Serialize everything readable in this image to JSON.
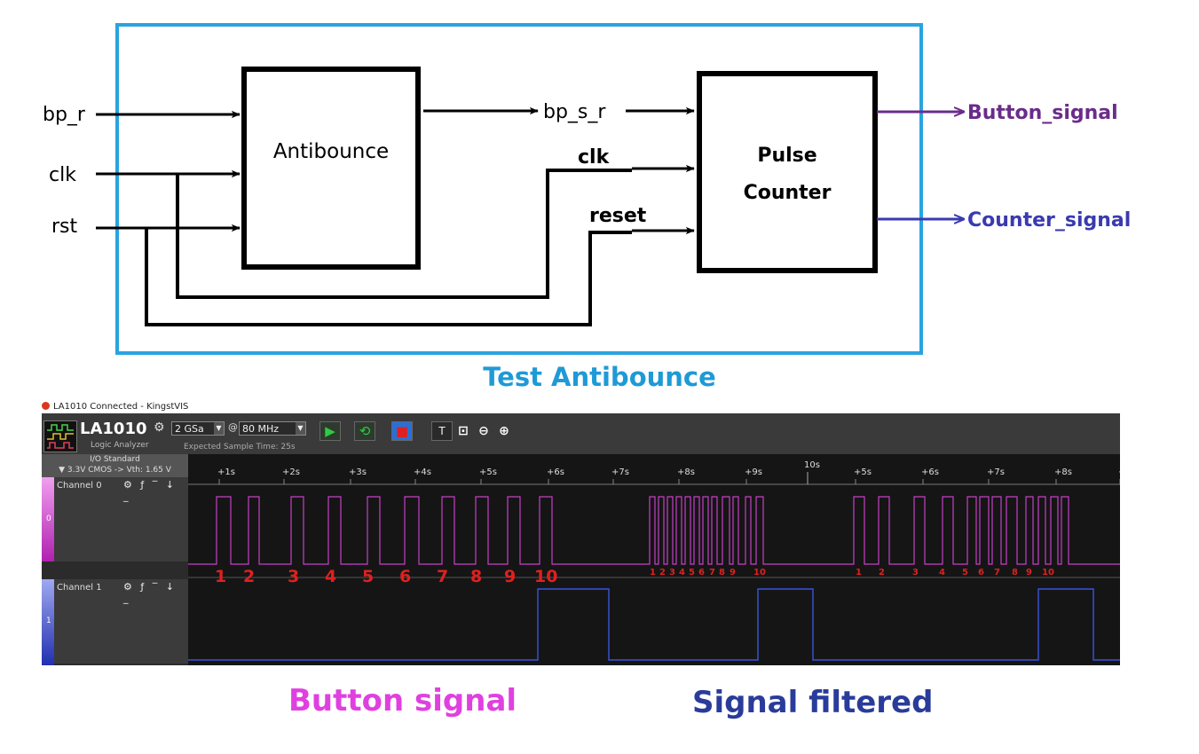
{
  "diagram": {
    "antibounce": {
      "label": "Antibounce"
    },
    "pulse_counter": {
      "line1": "Pulse",
      "line2": "Counter"
    },
    "inputs": [
      "bp_r",
      "clk",
      "rst"
    ],
    "middle_labels": {
      "bp_s_r": "bp_s_r",
      "clk": "clk",
      "reset": "reset"
    },
    "outputs": [
      {
        "label": "Button_signal",
        "color": "#6a2c8a"
      },
      {
        "label": "Counter_signal",
        "color": "#3a3ab0"
      }
    ],
    "frame_color": "#2aa3e0",
    "caption": "Test Antibounce"
  },
  "app": {
    "window_title": "LA1010 Connected - KingstVIS",
    "device_name": "LA1010",
    "device_sub": "Logic Analyzer",
    "sample_depth": "2 GSa",
    "at": "@",
    "sample_rate": "80 MHz",
    "expected_time": "Expected Sample Time: 25s",
    "io_standard_title": "I/O Standard",
    "io_standard_value": "▼ 3.3V CMOS -> Vth: 1.65 V",
    "channels": [
      {
        "name": "Channel 0",
        "index": "0",
        "color": "#d040d0"
      },
      {
        "name": "Channel 1",
        "index": "1",
        "color": "#3a50d0"
      }
    ],
    "channel_tools": "⚙ ƒ ‾ ↓ _",
    "timeline": {
      "marker": "10s",
      "ticks": [
        "+1s",
        "+2s",
        "+3s",
        "+4s",
        "+5s",
        "+6s",
        "+7s",
        "+8s",
        "+9s",
        "+5s",
        "+6s",
        "+7s",
        "+8s",
        "+"
      ]
    },
    "press_labels_large": [
      "1",
      "2",
      "3",
      "4",
      "5",
      "6",
      "7",
      "8",
      "9",
      "10"
    ],
    "press_labels_small_a": [
      "1",
      "2",
      "3",
      "4",
      "5",
      "6",
      "7",
      "8",
      "9",
      "10"
    ],
    "press_labels_small_b": [
      "1",
      "2",
      "3",
      "4",
      "5",
      "6",
      "7",
      "8",
      "9",
      "10"
    ],
    "annotation_color": "#e02020"
  },
  "captions": {
    "button": "Button signal",
    "filtered": "Signal filtered"
  }
}
